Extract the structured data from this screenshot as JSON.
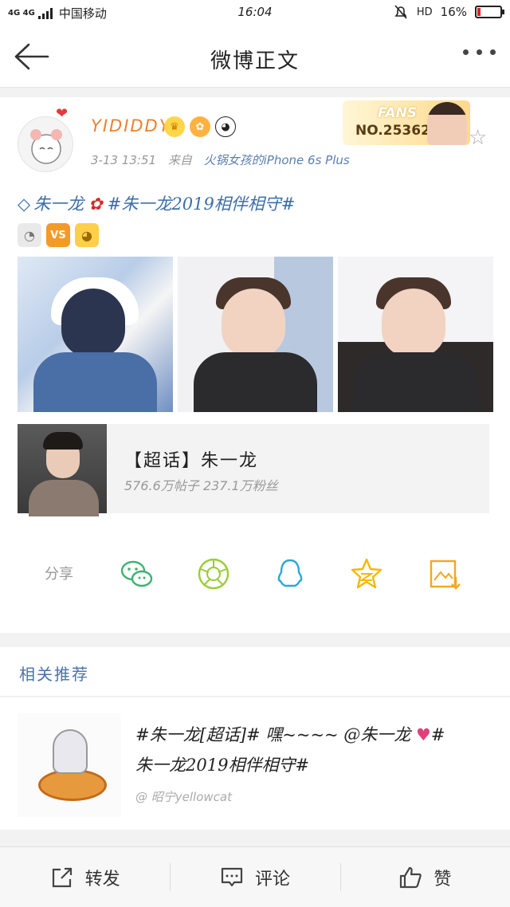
{
  "status_bar": {
    "network": "4G 4G",
    "carrier": "中国移动",
    "time": "16:04",
    "hd": "HD",
    "battery_pct": "16%",
    "battery_level": 0.16
  },
  "nav": {
    "title": "微博正文"
  },
  "post": {
    "username": "YIDIDDY",
    "fans_label": "FANS",
    "fans_no": "NO.253625",
    "time": "3-13 13:51",
    "from_label": "来自",
    "source": "火锅女孩的iPhone 6s Plus",
    "text_name": "朱一龙",
    "text_hashtag": "#朱一龙2019相伴相守#",
    "vs": "VS",
    "topic": {
      "name": "【超话】朱一龙",
      "stats": "576.6万帖子 237.1万粉丝"
    }
  },
  "share": {
    "label": "分享"
  },
  "related": {
    "header": "相关推荐",
    "text": "#朱一龙[超话]# 嘿~~~~ @朱一龙 #朱一龙2019相伴相守#",
    "text_line1": "#朱一龙[超话]# 嘿~~~~ @朱一龙",
    "text_line2": "#",
    "text_line3": "朱一龙2019相伴相守#",
    "author": "@ 昭宁yellowcat"
  },
  "actions": {
    "repost": "转发",
    "comment": "评论",
    "like": "赞"
  },
  "colors": {
    "accent_blue": "#3c6ea8",
    "username_orange": "#ee7f2d",
    "wechat_green": "#3cb371",
    "moments_green": "#9acd32",
    "qq_blue": "#2aa7d8",
    "qzone_yellow": "#f5b800",
    "save_orange": "#f5a623"
  },
  "icons": [
    "back-arrow-icon",
    "more-icon",
    "heart-icon",
    "crown-icon",
    "panda-icon",
    "star-icon",
    "diamond-icon",
    "rose-icon",
    "wechat-icon",
    "moments-icon",
    "qq-icon",
    "qzone-icon",
    "save-image-icon",
    "repost-icon",
    "comment-icon",
    "like-icon"
  ]
}
